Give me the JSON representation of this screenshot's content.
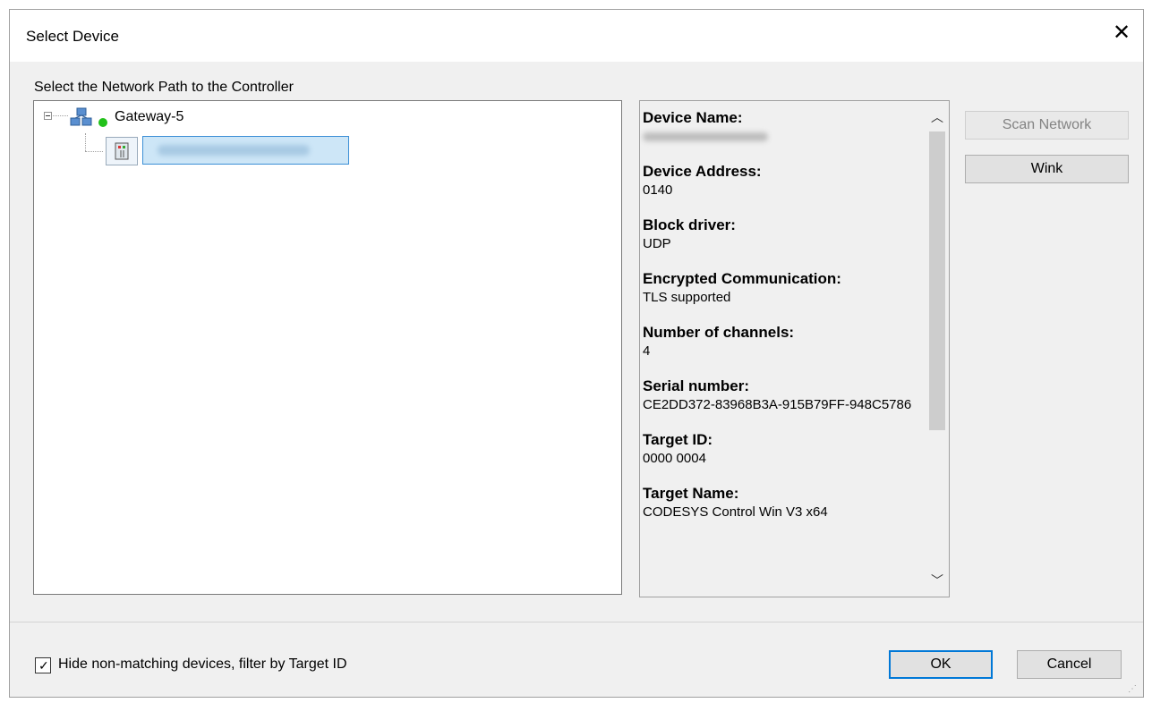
{
  "window": {
    "title": "Select Device",
    "close_glyph": "✕"
  },
  "tree_panel": {
    "prompt": "Select the Network Path to the Controller",
    "gateway": {
      "label": "Gateway-5",
      "status_color": "#22c11a",
      "icon": "network-gateway-icon"
    },
    "device": {
      "icon": "plc-device-icon",
      "label_redacted": true
    }
  },
  "device_info": {
    "items": [
      {
        "label": "Device Name:",
        "value": ""
      },
      {
        "label": "Device Address:",
        "value": "0140"
      },
      {
        "label": "Block driver:",
        "value": "UDP"
      },
      {
        "label": "Encrypted Communication:",
        "value": "TLS supported"
      },
      {
        "label": "Number of channels:",
        "value": "4"
      },
      {
        "label": "Serial number:",
        "value": "CE2DD372-83968B3A-915B79FF-948C5786"
      },
      {
        "label": "Target ID:",
        "value": "0000 0004"
      },
      {
        "label": "Target Name:",
        "value": "CODESYS Control Win V3 x64"
      }
    ],
    "scroll_up_glyph": "︿",
    "scroll_down_glyph": "﹀"
  },
  "side_buttons": {
    "scan_network": "Scan Network",
    "wink": "Wink"
  },
  "footer": {
    "filter_checkbox_label": "Hide non-matching devices, filter by Target ID",
    "filter_checked": true,
    "checkmark": "✓",
    "ok": "OK",
    "cancel": "Cancel"
  },
  "colors": {
    "accent": "#0078d7",
    "selection": "#cde6f7"
  }
}
